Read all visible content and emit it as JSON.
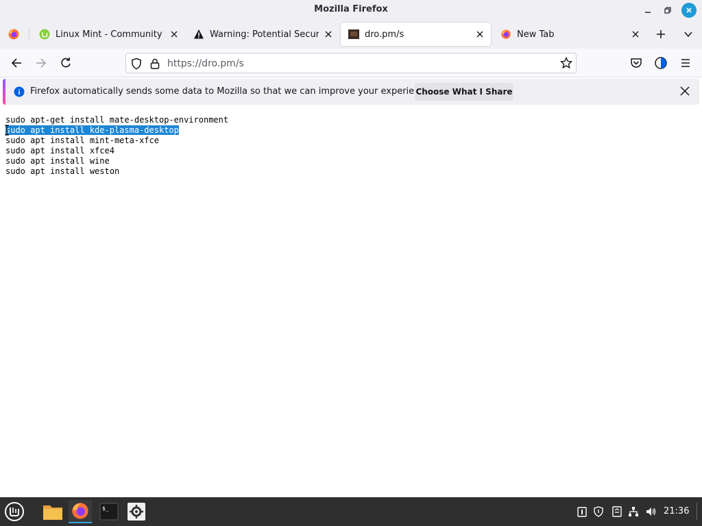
{
  "window": {
    "title": "Mozilla Firefox"
  },
  "tabs": [
    {
      "label": "Linux Mint - Community",
      "icon": "linux-mint-icon",
      "active": false
    },
    {
      "label": "Warning: Potential Security",
      "icon": "warning-icon",
      "active": false
    },
    {
      "label": "dro.pm/s",
      "icon": "site-favicon",
      "active": true
    },
    {
      "label": "New Tab",
      "icon": "firefox-icon",
      "active": false
    }
  ],
  "urlbar": {
    "url_host": "https://dro.pm",
    "url_path": "/s"
  },
  "notification": {
    "message": "Firefox automatically sends some data to Mozilla so that we can improve your experience.",
    "button_label": "Choose What I Share"
  },
  "page": {
    "lines": [
      "sudo apt-get install mate-desktop-environment",
      "sudo apt install kde-plasma-desktop",
      "sudo apt install mint-meta-xfce",
      "sudo apt install xfce4",
      "sudo apt install wine",
      "sudo apt install weston"
    ],
    "selected_line": 1
  },
  "taskbar": {
    "clock": "21:36",
    "apps": [
      "mint-menu-icon",
      "files-icon",
      "firefox-icon",
      "terminal-icon",
      "settings-icon"
    ]
  },
  "colors": {
    "accent": "#1e9bd7",
    "selection": "#1d86d4",
    "taskbar": "#2f2f2f"
  }
}
